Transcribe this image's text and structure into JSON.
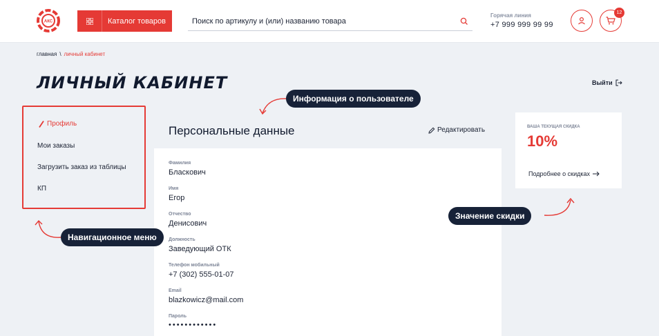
{
  "header": {
    "logo_text": "АКС",
    "catalog_label": "Каталог товаров",
    "search_placeholder": "Поиск по артикулу и (или) названию товара",
    "hotline_title": "Горячая линия",
    "hotline_phone": "+7 999 999 99 99",
    "cart_count": "12",
    "icons": {
      "search": "search-icon",
      "user": "user-icon",
      "cart": "cart-icon",
      "catalog": "grid-icon"
    }
  },
  "breadcrumb": {
    "home": "главная",
    "separator": "\\",
    "current": "личный кабинет"
  },
  "page": {
    "title": "ЛИЧНЫЙ КАБИНЕТ",
    "logout_label": "Выйти"
  },
  "nav": {
    "items": [
      {
        "label": "Профиль",
        "active": true
      },
      {
        "label": "Мои заказы"
      },
      {
        "label": "Загрузить заказ из таблицы"
      },
      {
        "label": "КП"
      }
    ]
  },
  "annotations": {
    "user_info": "Информация о пользователе",
    "nav_menu": "Навигационное меню",
    "discount_value": "Значение скидки"
  },
  "profile": {
    "section_title": "Персональные данные",
    "edit_label": "Редактировать",
    "fields": [
      {
        "label": "Фамилия",
        "value": "Бласкович"
      },
      {
        "label": "Имя",
        "value": "Егор"
      },
      {
        "label": "Отчество",
        "value": "Денисович"
      },
      {
        "label": "Должность",
        "value": "Заведующий ОТК"
      },
      {
        "label": "Телефон мобильный",
        "value": "+7 (302) 555-01-07"
      },
      {
        "label": "Email",
        "value": "blazkowicz@mail.com"
      },
      {
        "label": "Пароль",
        "value": "••••••••••••"
      }
    ]
  },
  "discount": {
    "label": "ВАША ТЕКУЩАЯ СКИДКА",
    "value": "10%",
    "link_label": "Подробнее о скидках"
  },
  "colors": {
    "accent": "#e53a35",
    "dark": "#172238",
    "background": "#eef1f5"
  }
}
